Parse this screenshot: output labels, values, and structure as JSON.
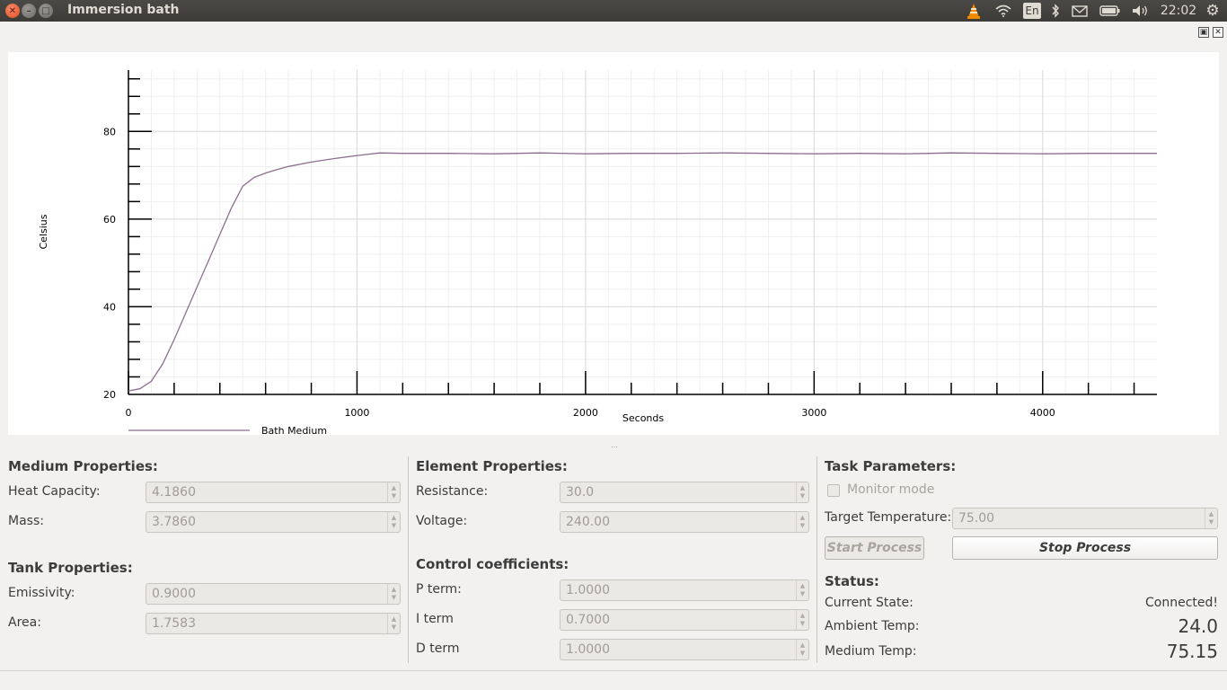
{
  "window": {
    "title": "Immersion bath"
  },
  "tray": {
    "lang": "En",
    "clock": "22:02"
  },
  "chart_data": {
    "type": "line",
    "title": "",
    "xlabel": "Seconds",
    "ylabel": "Celsius",
    "xlim": [
      0,
      4500
    ],
    "ylim": [
      20,
      94
    ],
    "x_ticks": [
      0,
      1000,
      2000,
      3000,
      4000
    ],
    "y_ticks": [
      20,
      40,
      60,
      80
    ],
    "grid": true,
    "legend": "bottom-left",
    "series": [
      {
        "name": "Bath Medium",
        "color": "#8e6e91",
        "x": [
          0,
          50,
          100,
          150,
          200,
          250,
          300,
          350,
          400,
          450,
          500,
          550,
          600,
          650,
          700,
          800,
          900,
          1000,
          1100,
          1200,
          1400,
          1600,
          1800,
          2000,
          2200,
          2400,
          2600,
          2800,
          3000,
          3200,
          3400,
          3600,
          3800,
          4000,
          4200,
          4400,
          4500
        ],
        "y": [
          20.8,
          21.3,
          23.0,
          27.0,
          32.5,
          38.5,
          44.5,
          50.5,
          56.5,
          62.5,
          67.5,
          69.5,
          70.5,
          71.3,
          72.0,
          73.0,
          73.8,
          74.5,
          75.1,
          75.0,
          75.0,
          74.9,
          75.1,
          74.9,
          75.0,
          75.0,
          75.1,
          75.0,
          74.9,
          75.0,
          74.9,
          75.1,
          75.0,
          74.9,
          75.0,
          75.0,
          75.0
        ]
      }
    ]
  },
  "medium": {
    "title": "Medium Properties:",
    "heat_capacity_label": "Heat Capacity:",
    "heat_capacity": "4.1860",
    "mass_label": "Mass:",
    "mass": "3.7860"
  },
  "tank": {
    "title": "Tank Properties:",
    "emissivity_label": "Emissivity:",
    "emissivity": "0.9000",
    "area_label": "Area:",
    "area": "1.7583"
  },
  "element": {
    "title": "Element Properties:",
    "resistance_label": "Resistance:",
    "resistance": "30.0",
    "voltage_label": "Voltage:",
    "voltage": "240.00"
  },
  "control": {
    "title": "Control coefficients:",
    "p_label": "P term:",
    "p": "1.0000",
    "i_label": "I term",
    "i": "0.7000",
    "d_label": "D term",
    "d": "1.0000"
  },
  "task": {
    "title": "Task Parameters:",
    "monitor_label": "Monitor mode",
    "target_label": "Target Temperature:",
    "target": "75.00",
    "start_label": "Start Process",
    "stop_label": "Stop Process"
  },
  "status": {
    "title": "Status:",
    "state_label": "Current State:",
    "state": "Connected!",
    "ambient_label": "Ambient Temp:",
    "ambient": "24.0",
    "medium_label": "Medium Temp:",
    "medium": "75.15"
  }
}
